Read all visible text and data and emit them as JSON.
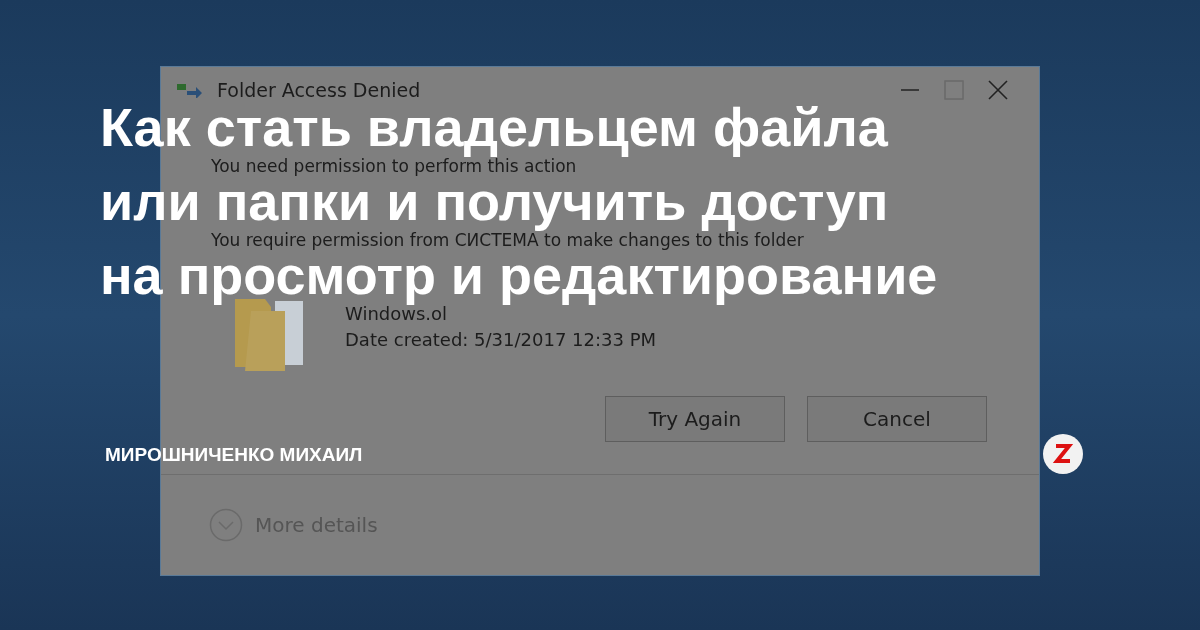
{
  "dialog": {
    "title": "Folder Access Denied",
    "heading": "You need permission to perform this action",
    "message": "You require permission from СИСТЕМА to make changes to this folder",
    "item_name": "Windows.ol",
    "item_date": "Date created: 5/31/2017 12:33 PM",
    "buttons": [
      "Try Again",
      "Cancel"
    ],
    "more_details": "More details"
  },
  "article": {
    "title_lines": [
      "Как стать владельцем файла",
      "или папки и получить доступ",
      "на просмотр и редактирование"
    ],
    "author": "МИРОШНИЧЕНКО МИХАИЛ"
  }
}
